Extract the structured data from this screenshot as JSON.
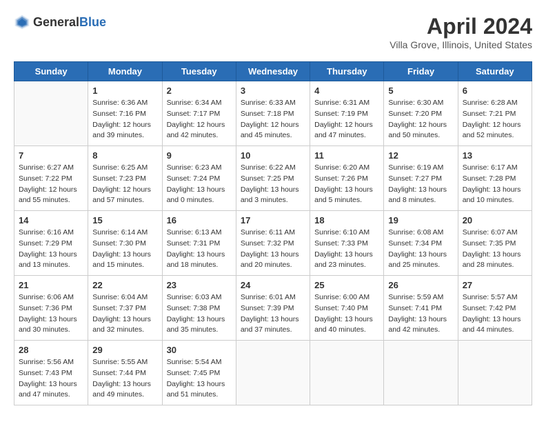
{
  "header": {
    "logo_general": "General",
    "logo_blue": "Blue",
    "title": "April 2024",
    "subtitle": "Villa Grove, Illinois, United States"
  },
  "weekdays": [
    "Sunday",
    "Monday",
    "Tuesday",
    "Wednesday",
    "Thursday",
    "Friday",
    "Saturday"
  ],
  "weeks": [
    [
      {
        "day": "",
        "sunrise": "",
        "sunset": "",
        "daylight": ""
      },
      {
        "day": "1",
        "sunrise": "Sunrise: 6:36 AM",
        "sunset": "Sunset: 7:16 PM",
        "daylight": "Daylight: 12 hours and 39 minutes."
      },
      {
        "day": "2",
        "sunrise": "Sunrise: 6:34 AM",
        "sunset": "Sunset: 7:17 PM",
        "daylight": "Daylight: 12 hours and 42 minutes."
      },
      {
        "day": "3",
        "sunrise": "Sunrise: 6:33 AM",
        "sunset": "Sunset: 7:18 PM",
        "daylight": "Daylight: 12 hours and 45 minutes."
      },
      {
        "day": "4",
        "sunrise": "Sunrise: 6:31 AM",
        "sunset": "Sunset: 7:19 PM",
        "daylight": "Daylight: 12 hours and 47 minutes."
      },
      {
        "day": "5",
        "sunrise": "Sunrise: 6:30 AM",
        "sunset": "Sunset: 7:20 PM",
        "daylight": "Daylight: 12 hours and 50 minutes."
      },
      {
        "day": "6",
        "sunrise": "Sunrise: 6:28 AM",
        "sunset": "Sunset: 7:21 PM",
        "daylight": "Daylight: 12 hours and 52 minutes."
      }
    ],
    [
      {
        "day": "7",
        "sunrise": "Sunrise: 6:27 AM",
        "sunset": "Sunset: 7:22 PM",
        "daylight": "Daylight: 12 hours and 55 minutes."
      },
      {
        "day": "8",
        "sunrise": "Sunrise: 6:25 AM",
        "sunset": "Sunset: 7:23 PM",
        "daylight": "Daylight: 12 hours and 57 minutes."
      },
      {
        "day": "9",
        "sunrise": "Sunrise: 6:23 AM",
        "sunset": "Sunset: 7:24 PM",
        "daylight": "Daylight: 13 hours and 0 minutes."
      },
      {
        "day": "10",
        "sunrise": "Sunrise: 6:22 AM",
        "sunset": "Sunset: 7:25 PM",
        "daylight": "Daylight: 13 hours and 3 minutes."
      },
      {
        "day": "11",
        "sunrise": "Sunrise: 6:20 AM",
        "sunset": "Sunset: 7:26 PM",
        "daylight": "Daylight: 13 hours and 5 minutes."
      },
      {
        "day": "12",
        "sunrise": "Sunrise: 6:19 AM",
        "sunset": "Sunset: 7:27 PM",
        "daylight": "Daylight: 13 hours and 8 minutes."
      },
      {
        "day": "13",
        "sunrise": "Sunrise: 6:17 AM",
        "sunset": "Sunset: 7:28 PM",
        "daylight": "Daylight: 13 hours and 10 minutes."
      }
    ],
    [
      {
        "day": "14",
        "sunrise": "Sunrise: 6:16 AM",
        "sunset": "Sunset: 7:29 PM",
        "daylight": "Daylight: 13 hours and 13 minutes."
      },
      {
        "day": "15",
        "sunrise": "Sunrise: 6:14 AM",
        "sunset": "Sunset: 7:30 PM",
        "daylight": "Daylight: 13 hours and 15 minutes."
      },
      {
        "day": "16",
        "sunrise": "Sunrise: 6:13 AM",
        "sunset": "Sunset: 7:31 PM",
        "daylight": "Daylight: 13 hours and 18 minutes."
      },
      {
        "day": "17",
        "sunrise": "Sunrise: 6:11 AM",
        "sunset": "Sunset: 7:32 PM",
        "daylight": "Daylight: 13 hours and 20 minutes."
      },
      {
        "day": "18",
        "sunrise": "Sunrise: 6:10 AM",
        "sunset": "Sunset: 7:33 PM",
        "daylight": "Daylight: 13 hours and 23 minutes."
      },
      {
        "day": "19",
        "sunrise": "Sunrise: 6:08 AM",
        "sunset": "Sunset: 7:34 PM",
        "daylight": "Daylight: 13 hours and 25 minutes."
      },
      {
        "day": "20",
        "sunrise": "Sunrise: 6:07 AM",
        "sunset": "Sunset: 7:35 PM",
        "daylight": "Daylight: 13 hours and 28 minutes."
      }
    ],
    [
      {
        "day": "21",
        "sunrise": "Sunrise: 6:06 AM",
        "sunset": "Sunset: 7:36 PM",
        "daylight": "Daylight: 13 hours and 30 minutes."
      },
      {
        "day": "22",
        "sunrise": "Sunrise: 6:04 AM",
        "sunset": "Sunset: 7:37 PM",
        "daylight": "Daylight: 13 hours and 32 minutes."
      },
      {
        "day": "23",
        "sunrise": "Sunrise: 6:03 AM",
        "sunset": "Sunset: 7:38 PM",
        "daylight": "Daylight: 13 hours and 35 minutes."
      },
      {
        "day": "24",
        "sunrise": "Sunrise: 6:01 AM",
        "sunset": "Sunset: 7:39 PM",
        "daylight": "Daylight: 13 hours and 37 minutes."
      },
      {
        "day": "25",
        "sunrise": "Sunrise: 6:00 AM",
        "sunset": "Sunset: 7:40 PM",
        "daylight": "Daylight: 13 hours and 40 minutes."
      },
      {
        "day": "26",
        "sunrise": "Sunrise: 5:59 AM",
        "sunset": "Sunset: 7:41 PM",
        "daylight": "Daylight: 13 hours and 42 minutes."
      },
      {
        "day": "27",
        "sunrise": "Sunrise: 5:57 AM",
        "sunset": "Sunset: 7:42 PM",
        "daylight": "Daylight: 13 hours and 44 minutes."
      }
    ],
    [
      {
        "day": "28",
        "sunrise": "Sunrise: 5:56 AM",
        "sunset": "Sunset: 7:43 PM",
        "daylight": "Daylight: 13 hours and 47 minutes."
      },
      {
        "day": "29",
        "sunrise": "Sunrise: 5:55 AM",
        "sunset": "Sunset: 7:44 PM",
        "daylight": "Daylight: 13 hours and 49 minutes."
      },
      {
        "day": "30",
        "sunrise": "Sunrise: 5:54 AM",
        "sunset": "Sunset: 7:45 PM",
        "daylight": "Daylight: 13 hours and 51 minutes."
      },
      {
        "day": "",
        "sunrise": "",
        "sunset": "",
        "daylight": ""
      },
      {
        "day": "",
        "sunrise": "",
        "sunset": "",
        "daylight": ""
      },
      {
        "day": "",
        "sunrise": "",
        "sunset": "",
        "daylight": ""
      },
      {
        "day": "",
        "sunrise": "",
        "sunset": "",
        "daylight": ""
      }
    ]
  ]
}
